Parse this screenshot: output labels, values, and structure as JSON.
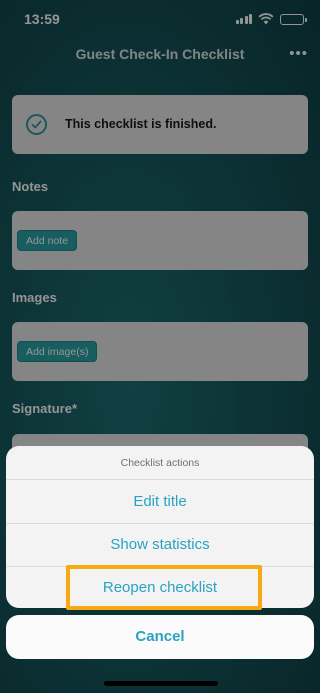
{
  "status_bar": {
    "time": "13:59",
    "icons": [
      "signal-icon",
      "wifi-icon",
      "battery-icon"
    ]
  },
  "nav": {
    "title": "Guest Check-In Checklist",
    "more_label": "•••"
  },
  "finished_banner": {
    "icon": "checkmark-circle-icon",
    "text": "This checklist is finished."
  },
  "sections": {
    "notes": {
      "label": "Notes",
      "button": "Add note"
    },
    "images": {
      "label": "Images",
      "button": "Add image(s)"
    },
    "signature": {
      "label": "Signature*"
    }
  },
  "action_sheet": {
    "title": "Checklist actions",
    "actions": [
      "Edit title",
      "Show statistics",
      "Reopen checklist"
    ],
    "cancel": "Cancel"
  },
  "colors": {
    "accent": "#2aa3c1",
    "button_teal": "#2aa3a8",
    "highlight": "#f7a813",
    "background": "#165a5f"
  }
}
